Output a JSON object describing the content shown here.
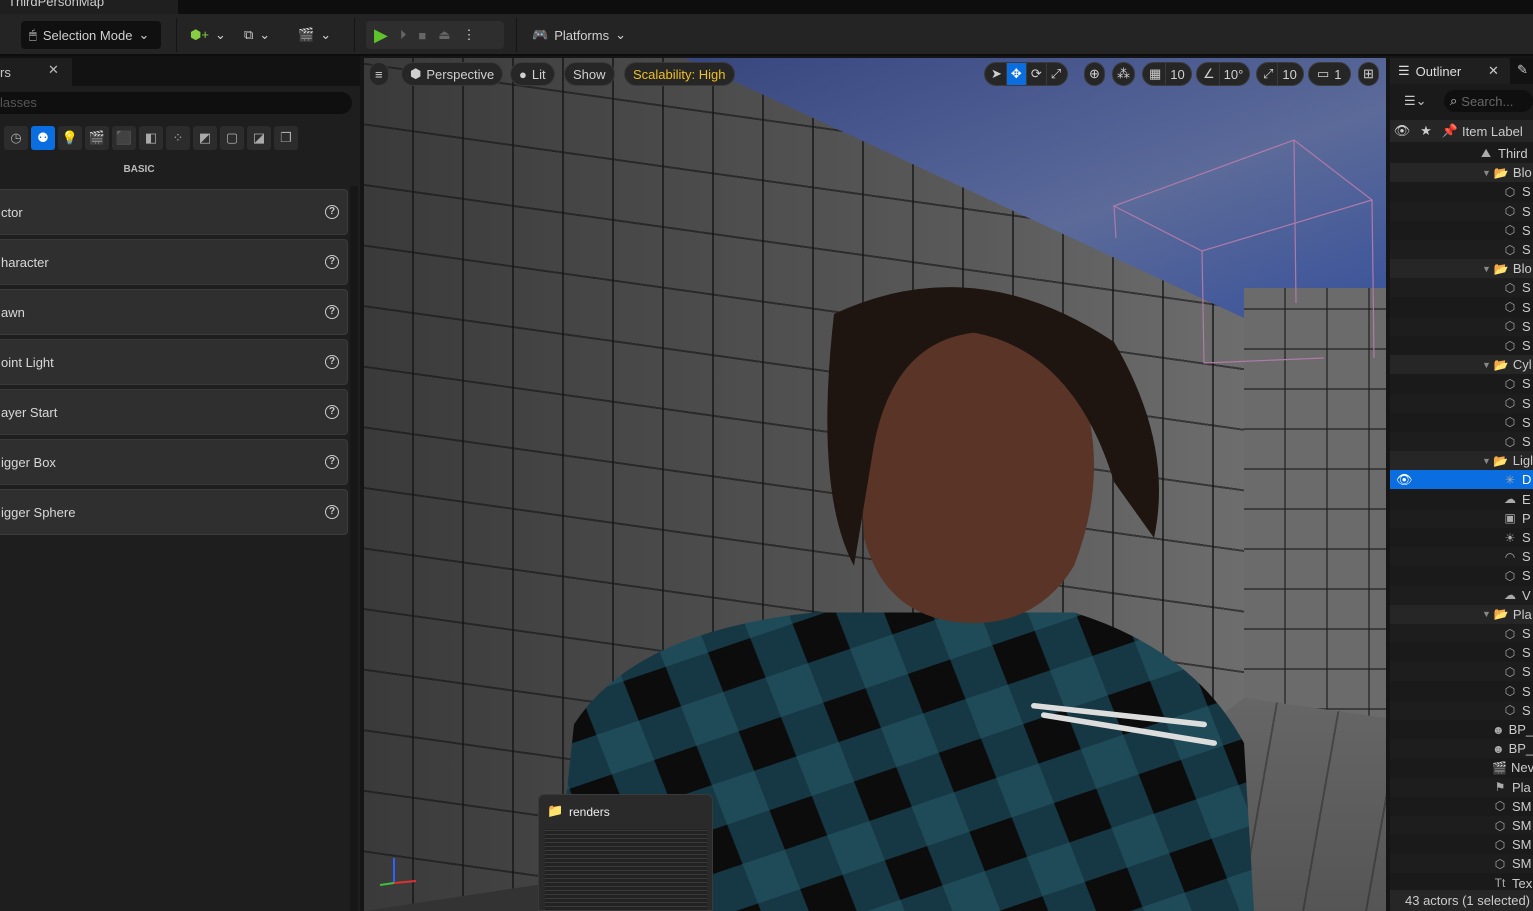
{
  "title_tab": "ThirdPersonMap",
  "toolbar": {
    "selection_mode": "Selection Mode",
    "platforms": "Platforms"
  },
  "left_panel": {
    "tab": "rs",
    "search_placeholder": "lasses",
    "category_icons": [
      "recent-icon",
      "basic-icon",
      "light-icon",
      "cinematic-icon",
      "visual-effects-icon",
      "volumes-icon",
      "all-classes-icon",
      "shapes-icon",
      "geometry-icon",
      "landscape-icon",
      "other-icon"
    ],
    "section": "BASIC",
    "items": [
      "ctor",
      "haracter",
      "awn",
      "oint Light",
      "ayer Start",
      "igger Box",
      "igger Sphere"
    ]
  },
  "viewport": {
    "menu": "≡",
    "perspective": "Perspective",
    "lit": "Lit",
    "show": "Show",
    "scalability": "Scalability: High",
    "grid_snap": "10",
    "rotation_snap": "10°",
    "scale_snap": "10",
    "camera_speed": "1",
    "accent": "#0a6ee0",
    "scalability_color": "#f0c020"
  },
  "taskbar_preview": {
    "title": "renders"
  },
  "outliner": {
    "tab": "Outliner",
    "search_placeholder": "Search...",
    "column": "Item Label",
    "rows": [
      {
        "label": "Third",
        "type": "level"
      },
      {
        "label": "Blo",
        "type": "folder"
      },
      {
        "label": "S",
        "type": "mesh"
      },
      {
        "label": "S",
        "type": "mesh"
      },
      {
        "label": "S",
        "type": "mesh"
      },
      {
        "label": "S",
        "type": "mesh"
      },
      {
        "label": "Blo",
        "type": "folder"
      },
      {
        "label": "S",
        "type": "mesh"
      },
      {
        "label": "S",
        "type": "mesh"
      },
      {
        "label": "S",
        "type": "mesh"
      },
      {
        "label": "S",
        "type": "mesh"
      },
      {
        "label": "Cyl",
        "type": "folder"
      },
      {
        "label": "S",
        "type": "mesh"
      },
      {
        "label": "S",
        "type": "mesh"
      },
      {
        "label": "S",
        "type": "mesh"
      },
      {
        "label": "S",
        "type": "mesh"
      },
      {
        "label": "Ligl",
        "type": "folder"
      },
      {
        "label": "D",
        "type": "light",
        "selected": true
      },
      {
        "label": "E",
        "type": "fog"
      },
      {
        "label": "P",
        "type": "volume"
      },
      {
        "label": "S",
        "type": "sky"
      },
      {
        "label": "S",
        "type": "skylight"
      },
      {
        "label": "S",
        "type": "mesh"
      },
      {
        "label": "V",
        "type": "cloud"
      },
      {
        "label": "Pla",
        "type": "folder"
      },
      {
        "label": "S",
        "type": "mesh"
      },
      {
        "label": "S",
        "type": "mesh"
      },
      {
        "label": "S",
        "type": "mesh"
      },
      {
        "label": "S",
        "type": "mesh"
      },
      {
        "label": "S",
        "type": "mesh"
      },
      {
        "label": "BP_",
        "type": "pawn"
      },
      {
        "label": "BP_",
        "type": "pawn"
      },
      {
        "label": "Nev",
        "type": "sequence"
      },
      {
        "label": "Pla",
        "type": "playerstart"
      },
      {
        "label": "SM",
        "type": "mesh"
      },
      {
        "label": "SM",
        "type": "mesh"
      },
      {
        "label": "SM",
        "type": "mesh"
      },
      {
        "label": "SM",
        "type": "mesh"
      },
      {
        "label": "Tex",
        "type": "text"
      }
    ],
    "footer": "43 actors (1 selected)"
  }
}
